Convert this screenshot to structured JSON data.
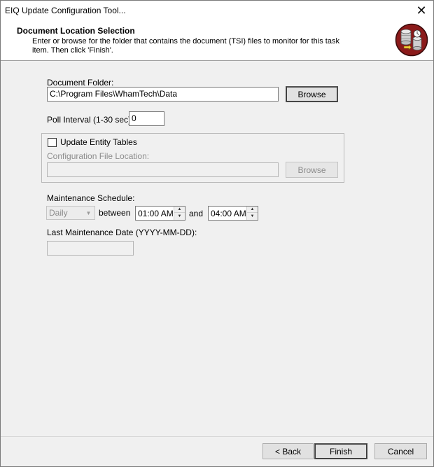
{
  "window": {
    "title": "EIQ Update Configuration Tool..."
  },
  "header": {
    "title": "Document Location Selection",
    "description": "Enter or browse for the folder that contains the document (TSI) files to monitor for this task item. Then click 'Finish'.",
    "icon": "database-sync-icon"
  },
  "document_folder": {
    "label": "Document Folder:",
    "value": "C:\\Program Files\\WhamTech\\Data",
    "browse_label": "Browse"
  },
  "poll_interval": {
    "label": "Poll Interval (1-30 sec):",
    "value": "0"
  },
  "entity_tables": {
    "checkbox_label": "Update Entity Tables",
    "checked": false,
    "config_label": "Configuration File Location:",
    "config_value": "",
    "browse_label": "Browse"
  },
  "maintenance": {
    "label": "Maintenance Schedule:",
    "frequency": "Daily",
    "between_label": "between",
    "start_time": "01:00 AM",
    "and_label": "and",
    "end_time": "04:00 AM",
    "last_date_label": "Last Maintenance Date (YYYY-MM-DD):",
    "last_date_value": ""
  },
  "footer": {
    "back_label": "< Back",
    "finish_label": "Finish",
    "cancel_label": "Cancel"
  },
  "colors": {
    "icon_red": "#8b1a1a",
    "title_bg": "#ffffff",
    "dialog_bg": "#f0f0f0"
  }
}
